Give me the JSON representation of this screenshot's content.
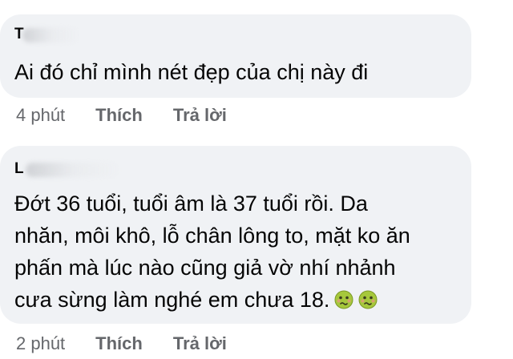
{
  "comments": [
    {
      "author": "T",
      "text": "Ai đó chỉ mình nét đẹp của chị này đi",
      "time": "4 phút",
      "like": "Thích",
      "reply": "Trả lời"
    },
    {
      "author": "L",
      "text_lines": [
        "Đớt 36 tuổi, tuổi âm là 37 tuổi rồi. Da",
        "nhăn, môi khô, lỗ chân lông to, mặt ko ăn",
        "phấn mà lúc nào cũng giả vờ nhí nhảnh",
        "cưa sừng làm nghé em chưa 18."
      ],
      "emojis": [
        "nauseated-face-icon",
        "nauseated-face-icon"
      ],
      "time": "2 phút",
      "like": "Thích",
      "reply": "Trả lời"
    }
  ],
  "colors": {
    "bubble": "#f0f2f5",
    "text": "#050505",
    "meta": "#65676b",
    "emoji_face": "#a6c83c"
  }
}
